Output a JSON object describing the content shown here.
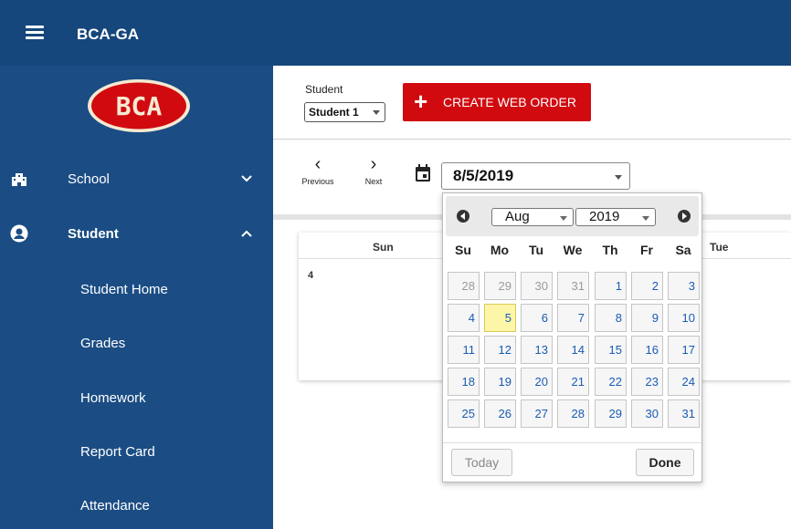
{
  "app": {
    "title": "BCA-GA",
    "logo_text": "BCA",
    "accent": "#15477c",
    "sidebar_color": "#1b4d84",
    "brand_red": "#d10a10"
  },
  "sidebar": {
    "school": {
      "label": "School",
      "icon": "school-building-icon"
    },
    "student": {
      "label": "Student",
      "icon": "account-circle-icon"
    },
    "sub_items": [
      "Student Home",
      "Grades",
      "Homework",
      "Report Card",
      "Attendance"
    ]
  },
  "header": {
    "student_label": "Student",
    "student_selected": "Student 1",
    "create_button": "CREATE WEB ORDER"
  },
  "navigation": {
    "previous": "Previous",
    "next": "Next",
    "date_value": "8/5/2019"
  },
  "calendar": {
    "col_sun": "Sun",
    "col_tue": "Tue",
    "first_day": "4"
  },
  "datepicker": {
    "month": "Aug",
    "year": "2019",
    "weekdays": [
      "Su",
      "Mo",
      "Tu",
      "We",
      "Th",
      "Fr",
      "Sa"
    ],
    "weeks": [
      [
        "28",
        "29",
        "30",
        "31",
        "1",
        "2",
        "3"
      ],
      [
        "4",
        "5",
        "6",
        "7",
        "8",
        "9",
        "10"
      ],
      [
        "11",
        "12",
        "13",
        "14",
        "15",
        "16",
        "17"
      ],
      [
        "18",
        "19",
        "20",
        "21",
        "22",
        "23",
        "24"
      ],
      [
        "25",
        "26",
        "27",
        "28",
        "29",
        "30",
        "31"
      ]
    ],
    "selected_day": "5",
    "today_button": "Today",
    "done_button": "Done"
  }
}
